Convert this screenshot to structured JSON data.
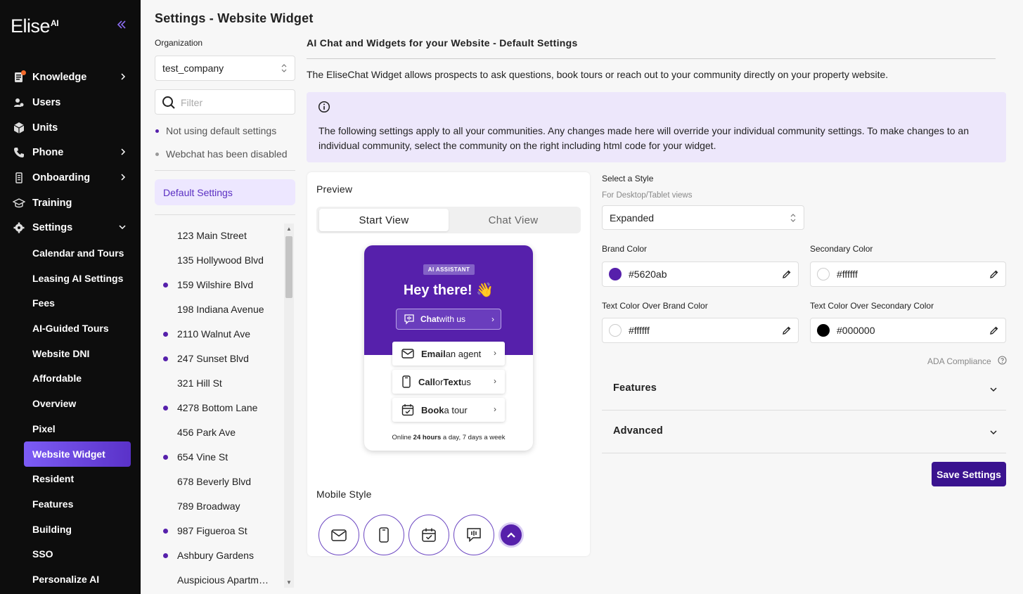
{
  "sidebar": {
    "logo_text": "Elise",
    "logo_sup": "AI",
    "collapse_glyph": "«",
    "nav": [
      {
        "label": "Knowledge",
        "icon": "knowledge-icon",
        "has_chevron": true,
        "notification": true
      },
      {
        "label": "Users",
        "icon": "users-icon",
        "has_chevron": false
      },
      {
        "label": "Units",
        "icon": "units-icon",
        "has_chevron": false
      },
      {
        "label": "Phone",
        "icon": "phone-icon",
        "has_chevron": true
      },
      {
        "label": "Onboarding",
        "icon": "onboarding-icon",
        "has_chevron": true
      },
      {
        "label": "Training",
        "icon": "training-icon",
        "has_chevron": false
      },
      {
        "label": "Settings",
        "icon": "gear-icon",
        "has_chevron": true,
        "expanded": true
      }
    ],
    "settings_sub": [
      "Calendar and Tours",
      "Leasing AI Settings",
      "Fees",
      "AI-Guided Tours",
      "Website DNI",
      "Affordable",
      "Overview",
      "Pixel",
      "Website Widget",
      "Resident",
      "Features",
      "Building",
      "SSO",
      "Personalize AI"
    ],
    "active_sub": "Website Widget"
  },
  "page": {
    "title": "Settings - Website Widget"
  },
  "org": {
    "label": "Organization",
    "selected": "test_company",
    "filter_placeholder": "Filter",
    "legend_not_default": "Not using default settings",
    "legend_disabled": "Webchat has been disabled",
    "default_settings": "Default Settings",
    "communities": [
      {
        "name": "123 Main Street",
        "custom": false
      },
      {
        "name": "135 Hollywood Blvd",
        "custom": false
      },
      {
        "name": "159 Wilshire Blvd",
        "custom": true
      },
      {
        "name": "198 Indiana Avenue",
        "custom": false
      },
      {
        "name": "2110 Walnut Ave",
        "custom": true
      },
      {
        "name": "247 Sunset Blvd",
        "custom": true
      },
      {
        "name": "321 Hill St",
        "custom": false
      },
      {
        "name": "4278 Bottom Lane",
        "custom": true
      },
      {
        "name": "456 Park Ave",
        "custom": false
      },
      {
        "name": "654 Vine St",
        "custom": true
      },
      {
        "name": "678 Beverly Blvd",
        "custom": false
      },
      {
        "name": "789 Broadway",
        "custom": false
      },
      {
        "name": "987 Figueroa St",
        "custom": true
      },
      {
        "name": "Ashbury Gardens",
        "custom": true
      },
      {
        "name": "Auspicious Apartme...",
        "custom": false
      }
    ]
  },
  "main": {
    "section_title": "AI Chat and Widgets for your Website - Default Settings",
    "description": "The EliseChat Widget allows prospects to ask questions, book tours or reach out to your community directly on your property website.",
    "info_text": "The following settings apply to all your communities. Any changes made here will override your individual community settings. To make changes to an individual community, select the community on the right including html code for your widget."
  },
  "preview": {
    "label": "Preview",
    "tab_start": "Start View",
    "tab_chat": "Chat View",
    "badge": "AI ASSISTANT",
    "greeting": "Hey there! 👋",
    "chat_bold": "Chat",
    "chat_rest": " with us",
    "email_bold": "Email",
    "email_rest": " an agent",
    "call_bold": "Call",
    "call_mid": " or ",
    "call_bold2": "Text",
    "call_rest": " us",
    "tour_bold": "Book",
    "tour_rest": " a tour",
    "online_pre": "Online ",
    "online_bold": "24 hours",
    "online_post": " a day, 7 days a week",
    "mobile_label": "Mobile Style"
  },
  "style": {
    "label": "Select a Style",
    "sub": "For Desktop/Tablet views",
    "selected": "Expanded",
    "brand_label": "Brand Color",
    "brand_value": "#5620ab",
    "secondary_label": "Secondary Color",
    "secondary_value": "#ffffff",
    "text_brand_label": "Text Color Over Brand Color",
    "text_brand_value": "#ffffff",
    "text_secondary_label": "Text Color Over Secondary Color",
    "text_secondary_value": "#000000",
    "ada": "ADA Compliance",
    "features": "Features",
    "advanced": "Advanced",
    "save": "Save Settings"
  },
  "colors": {
    "brand": "#5620ab",
    "accent": "#7c5cf5",
    "save": "#3a138f",
    "info_bg": "#ede7fb"
  }
}
